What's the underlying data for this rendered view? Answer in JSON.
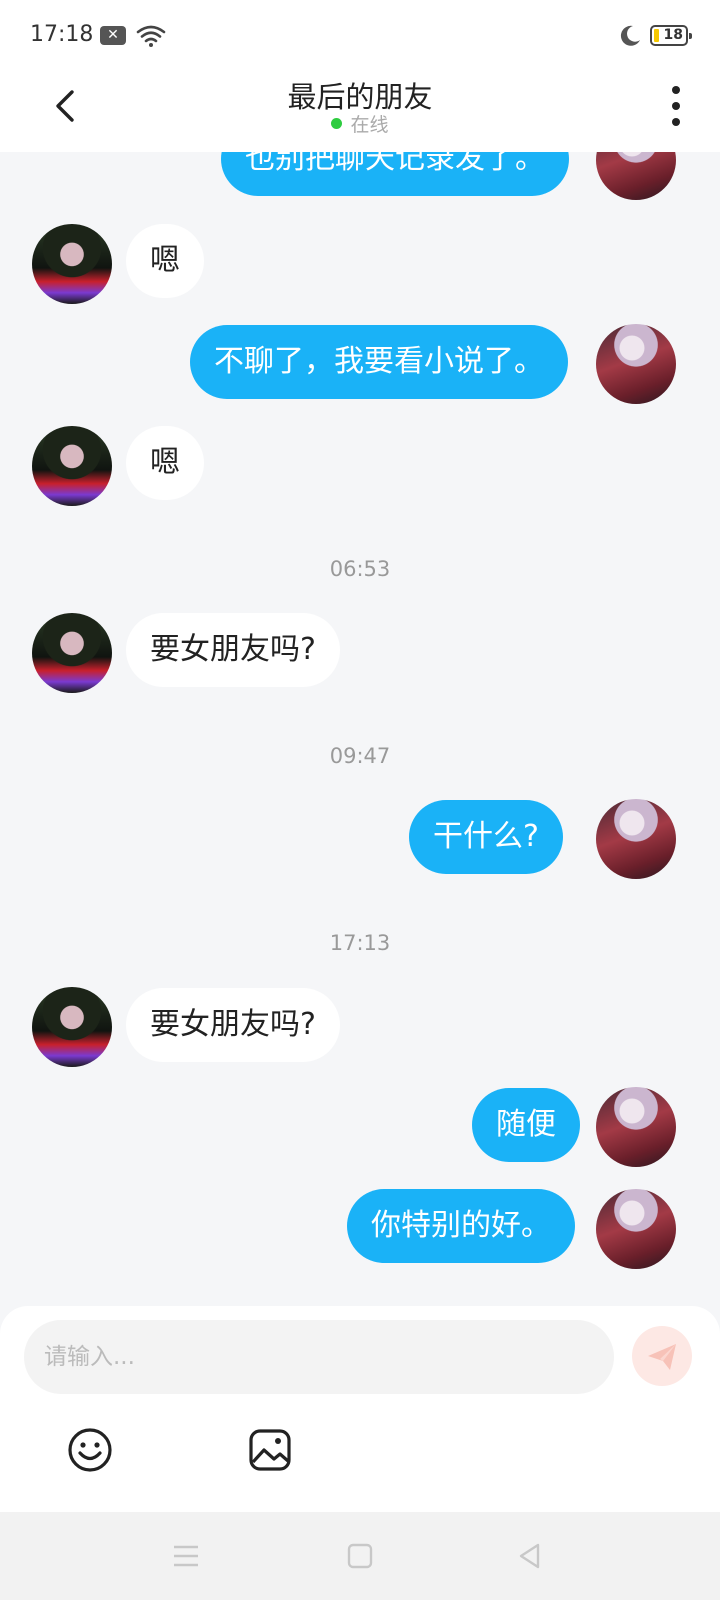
{
  "status_bar": {
    "time": "17:18",
    "notification_icon": "close-icon",
    "battery": "18",
    "colors": {
      "battery_fill": "#f5c800"
    }
  },
  "header": {
    "title": "最后的朋友",
    "status": "在线",
    "colors": {
      "online_dot": "#2ecc40"
    }
  },
  "messages": [
    {
      "side": "right",
      "text": "也别把聊天记录发了。"
    },
    {
      "side": "left",
      "text": "嗯"
    },
    {
      "side": "right",
      "text": "不聊了，我要看小说了。"
    },
    {
      "side": "left",
      "text": "嗯"
    },
    {
      "side": "time",
      "text": "06:53"
    },
    {
      "side": "left",
      "text": "要女朋友吗?"
    },
    {
      "side": "time",
      "text": "09:47"
    },
    {
      "side": "right",
      "text": "干什么?"
    },
    {
      "side": "time",
      "text": "17:13"
    },
    {
      "side": "left",
      "text": "要女朋友吗?"
    },
    {
      "side": "right",
      "text": "随便"
    },
    {
      "side": "right",
      "text": "你特别的好。"
    }
  ],
  "input": {
    "placeholder": "请输入..."
  },
  "toolbar": {
    "icons": [
      "emoji-icon",
      "image-icon",
      "send-icon"
    ]
  },
  "colors": {
    "my_bubble": "#1ab2f7",
    "their_bubble": "#ffffff",
    "background": "#f5f6f8",
    "send_button": "#fde8e4"
  }
}
